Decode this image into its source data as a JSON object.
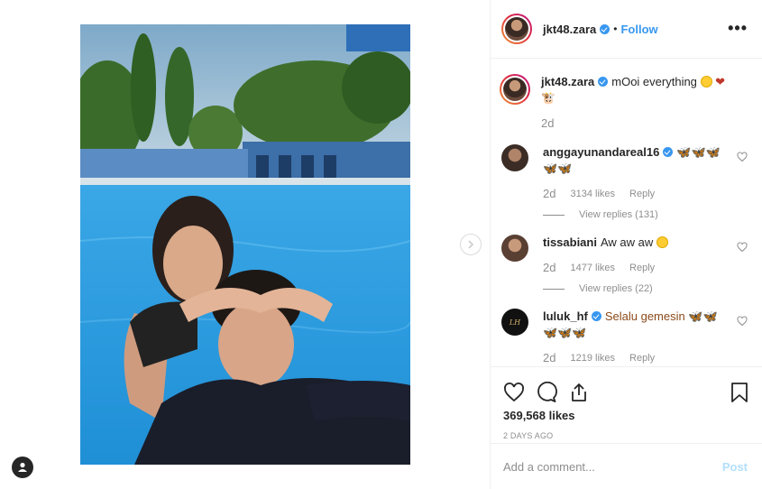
{
  "post": {
    "username": "jkt48.zara",
    "follow_label": "Follow",
    "dot": "•",
    "more_label": "•••"
  },
  "caption": {
    "username": "jkt48.zara",
    "text": "mOoi everything",
    "time": "2d"
  },
  "comments": [
    {
      "username": "anggayunandareal16",
      "verified": true,
      "text": "🦋🦋🦋 🦋🦋",
      "time": "2d",
      "likes": "3134 likes",
      "reply_label": "Reply",
      "view_replies": "View replies (131)"
    },
    {
      "username": "tissabiani",
      "verified": false,
      "text": "Aw aw aw",
      "time": "2d",
      "likes": "1477 likes",
      "reply_label": "Reply",
      "view_replies": "View replies (22)"
    },
    {
      "username": "luluk_hf",
      "verified": true,
      "text": "Selalu gemesin 🦋🦋 🦋🦋🦋",
      "time": "2d",
      "likes": "1219 likes",
      "reply_label": "Reply"
    }
  ],
  "actions": {
    "likes_count": "369,568 likes",
    "posted_ago": "2 DAYS AGO"
  },
  "add_comment": {
    "placeholder": "Add a comment...",
    "post_label": "Post"
  },
  "colors": {
    "accent": "#3897f0",
    "post_disabled": "#b2dffc",
    "pool": "#2a9fe0"
  },
  "icons": [
    "heart-icon",
    "comment-icon",
    "share-icon",
    "bookmark-icon",
    "verified-icon",
    "chevron-right-icon",
    "account-icon"
  ]
}
